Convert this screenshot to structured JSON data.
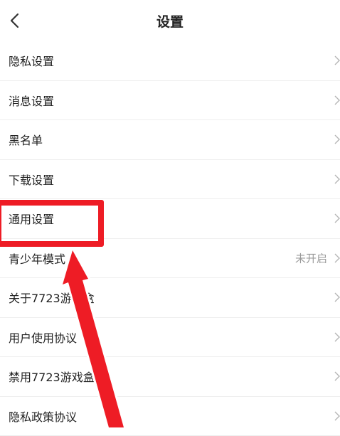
{
  "header": {
    "title": "设置",
    "back_icon": "chevron-left-icon"
  },
  "settings": {
    "items": [
      {
        "label": "隐私设置",
        "value": ""
      },
      {
        "label": "消息设置",
        "value": ""
      },
      {
        "label": "黑名单",
        "value": ""
      },
      {
        "label": "下载设置",
        "value": ""
      },
      {
        "label": "通用设置",
        "value": ""
      },
      {
        "label": "青少年模式",
        "value": "未开启"
      },
      {
        "label": "关于7723游戏盒",
        "value": ""
      },
      {
        "label": "用户使用协议",
        "value": ""
      },
      {
        "label": "禁用7723游戏盒",
        "value": ""
      },
      {
        "label": "隐私政策协议",
        "value": ""
      }
    ]
  },
  "annotation": {
    "color": "#ee1c25",
    "highlighted_item": "通用设置"
  }
}
